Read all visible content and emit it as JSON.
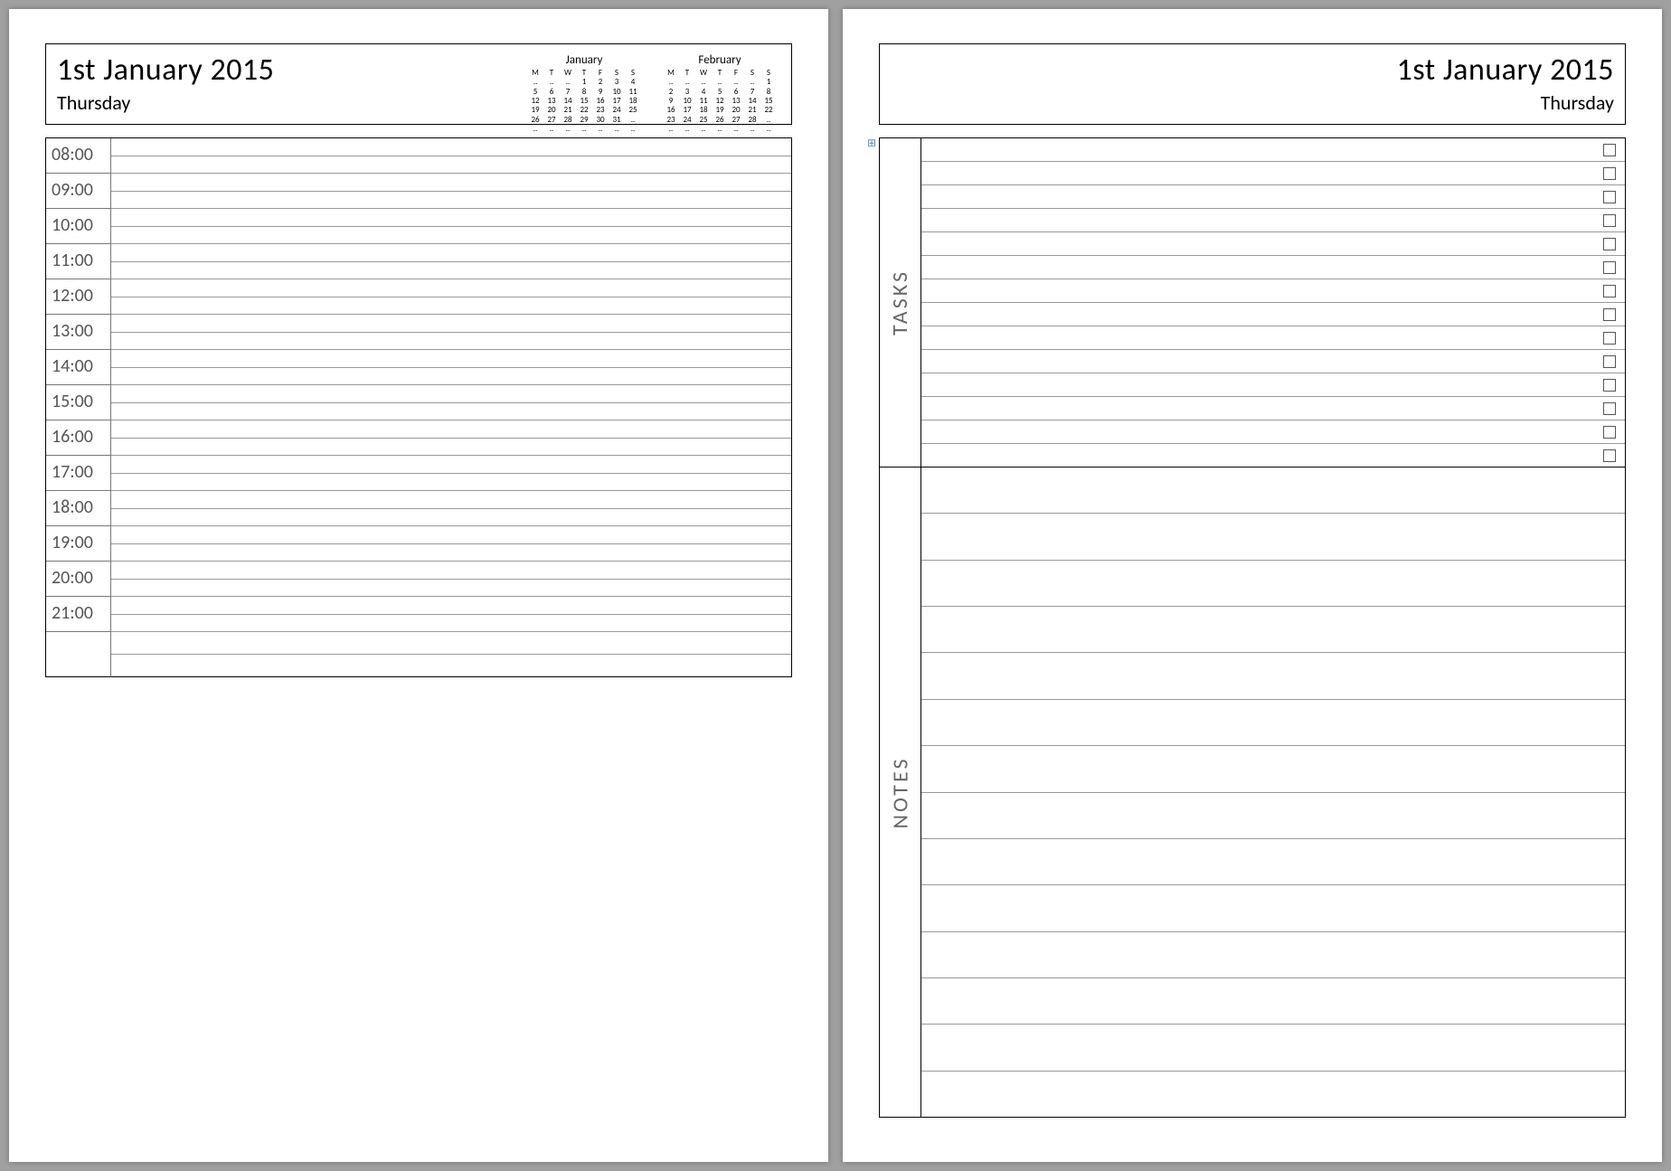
{
  "date": "1st January 2015",
  "weekday": "Thursday",
  "schedule_times": [
    "08:00",
    "09:00",
    "10:00",
    "11:00",
    "12:00",
    "13:00",
    "14:00",
    "15:00",
    "16:00",
    "17:00",
    "18:00",
    "19:00",
    "20:00",
    "21:00"
  ],
  "tasks_label": "TASKS",
  "notes_label": "NOTES",
  "task_count": 14,
  "note_count": 14,
  "mini_calendars": [
    {
      "title": "January",
      "dow": [
        "M",
        "T",
        "W",
        "T",
        "F",
        "S",
        "S"
      ],
      "rows": [
        [
          "..",
          "..",
          "..",
          "1",
          "2",
          "3",
          "4"
        ],
        [
          "5",
          "6",
          "7",
          "8",
          "9",
          "10",
          "11"
        ],
        [
          "12",
          "13",
          "14",
          "15",
          "16",
          "17",
          "18"
        ],
        [
          "19",
          "20",
          "21",
          "22",
          "23",
          "24",
          "25"
        ],
        [
          "26",
          "27",
          "28",
          "29",
          "30",
          "31",
          ".."
        ],
        [
          "..",
          "..",
          "..",
          "..",
          "..",
          "..",
          ".."
        ]
      ]
    },
    {
      "title": "February",
      "dow": [
        "M",
        "T",
        "W",
        "T",
        "F",
        "S",
        "S"
      ],
      "rows": [
        [
          "..",
          "..",
          "..",
          "..",
          "..",
          "..",
          "1"
        ],
        [
          "2",
          "3",
          "4",
          "5",
          "6",
          "7",
          "8"
        ],
        [
          "9",
          "10",
          "11",
          "12",
          "13",
          "14",
          "15"
        ],
        [
          "16",
          "17",
          "18",
          "19",
          "20",
          "21",
          "22"
        ],
        [
          "23",
          "24",
          "25",
          "26",
          "27",
          "28",
          ".."
        ],
        [
          "..",
          "..",
          "..",
          "..",
          "..",
          "..",
          ".."
        ]
      ]
    }
  ]
}
